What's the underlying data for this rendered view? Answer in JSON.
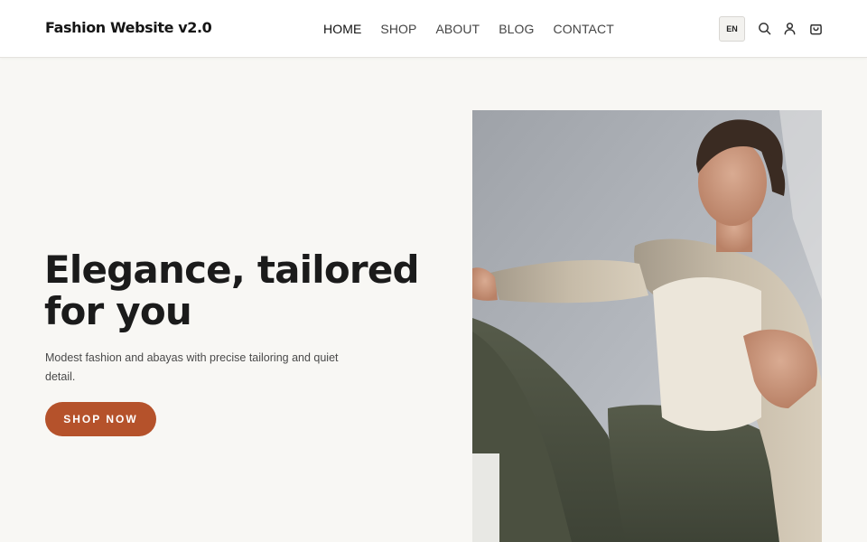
{
  "header": {
    "logo": "Fashion Website v2.0",
    "nav": [
      {
        "label": "HOME",
        "active": true
      },
      {
        "label": "SHOP",
        "active": false
      },
      {
        "label": "ABOUT",
        "active": false
      },
      {
        "label": "BLOG",
        "active": false
      },
      {
        "label": "CONTACT",
        "active": false
      }
    ],
    "language": "EN",
    "icons": [
      "search-icon",
      "user-icon",
      "cart-icon"
    ]
  },
  "hero": {
    "title": "Elegance, tailored for you",
    "subtitle": "Modest fashion and abayas with precise tailoring and quiet detail.",
    "cta_label": "SHOP NOW",
    "image_subject": "male-model-beige-blazer-photo"
  },
  "colors": {
    "accent": "#b5522b",
    "background": "#f8f7f4",
    "header_bg": "#ffffff",
    "text": "#1b1b1b"
  }
}
